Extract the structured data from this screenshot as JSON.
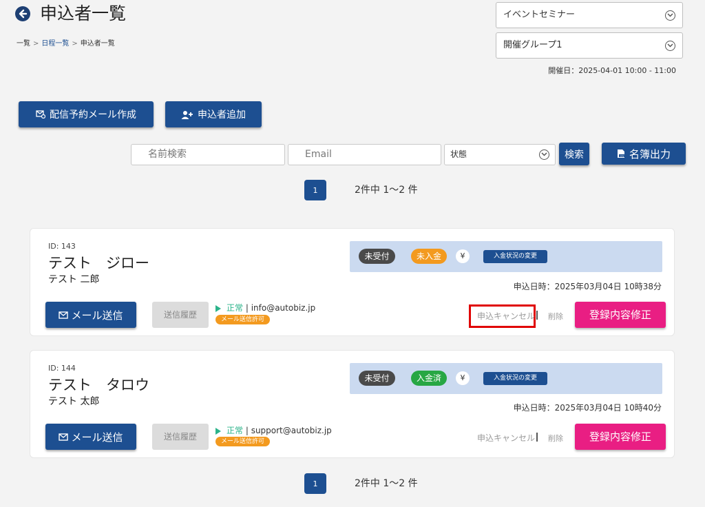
{
  "header": {
    "title": "申込者一覧",
    "breadcrumb": [
      {
        "label": "一覧",
        "link": false
      },
      {
        "label": "日程一覧",
        "link": true
      },
      {
        "label": "申込者一覧",
        "link": false
      }
    ],
    "breadcrumb_sep": ">",
    "event_select": "イベントセミナー",
    "group_select": "開催グループ1",
    "event_date": "開催日：2025-04-01 10:00 - 11:00"
  },
  "actions": {
    "reserve_mail": "配信予約メール作成",
    "add_applicant": "申込者追加"
  },
  "search": {
    "name_placeholder": "名前検索",
    "email_placeholder": "Email",
    "status_select": "状態",
    "search_button": "検索",
    "export_button": "名簿出力"
  },
  "pager": {
    "current_page": "1",
    "count_text": "2件中 1〜2 件"
  },
  "applicants": [
    {
      "id": "ID: 143",
      "name": "テスト　ジロー",
      "name_sub": "テスト 二郎",
      "reception_status": "未受付",
      "payment_status": "未入金",
      "payment_color": "#f39a1f",
      "yen": "¥",
      "change_payment": "入金状況の変更",
      "apply_date": "申込日時：2025年03月04日 10時38分",
      "mail_button": "メール送信",
      "history_button": "送信履歴",
      "mail_ok": "正常",
      "email": " | info@autobiz.jp",
      "mail_permit": "メール送信許可",
      "cancel": "申込キャンセル",
      "delete": "削除",
      "edit_button": "登録内容修正"
    },
    {
      "id": "ID: 144",
      "name": "テスト　タロウ",
      "name_sub": "テスト 太郎",
      "reception_status": "未受付",
      "payment_status": "入金済",
      "payment_color": "#27a744",
      "yen": "¥",
      "change_payment": "入金状況の変更",
      "apply_date": "申込日時：2025年03月04日 10時40分",
      "mail_button": "メール送信",
      "history_button": "送信履歴",
      "mail_ok": "正常",
      "email": " | support@autobiz.jp",
      "mail_permit": "メール送信許可",
      "cancel": "申込キャンセル",
      "delete": "削除",
      "edit_button": "登録内容修正"
    }
  ],
  "colors": {
    "primary": "#1d4f91",
    "pink": "#e91e83",
    "highlight": "#e00000"
  }
}
